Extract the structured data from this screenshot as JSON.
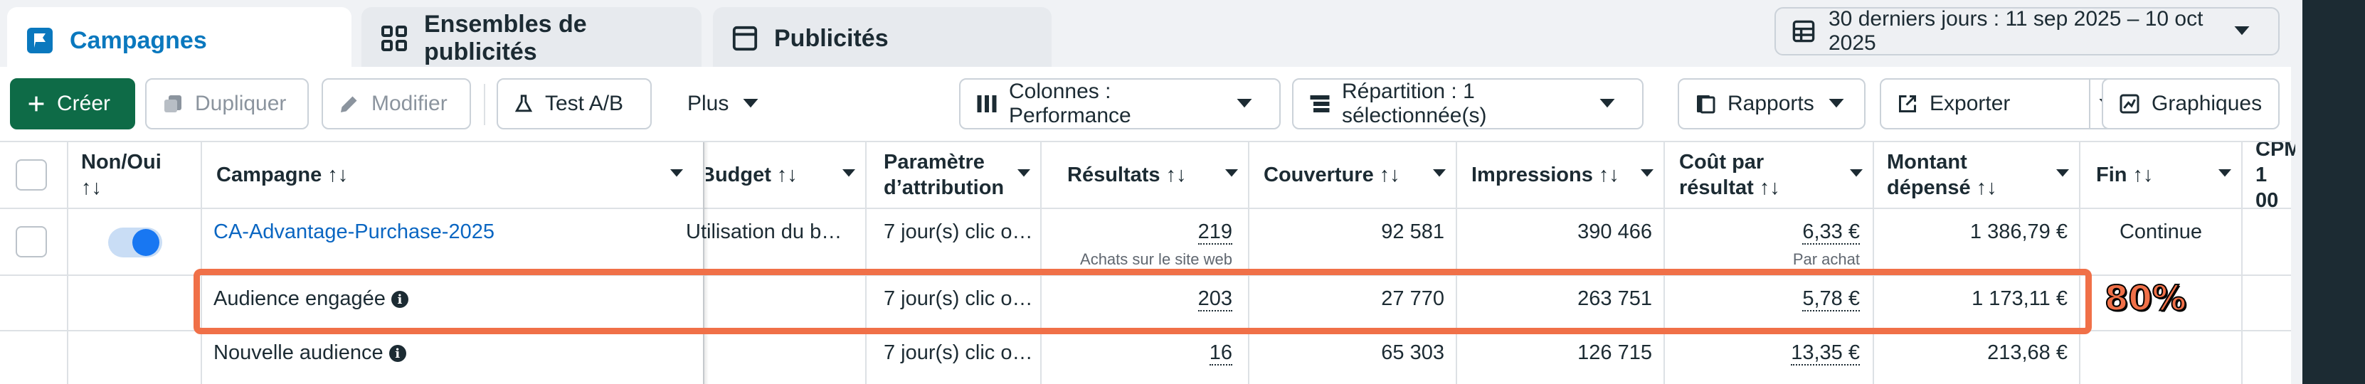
{
  "tabs": [
    {
      "label": "Campagnes",
      "icon": "flag-icon",
      "active": true
    },
    {
      "label": "Ensembles de publicités",
      "icon": "grid-icon",
      "active": false
    },
    {
      "label": "Publicités",
      "icon": "ad-card-icon",
      "active": false
    }
  ],
  "date_range": {
    "label": "30 derniers jours : 11 sep 2025 – 10 oct 2025",
    "icon": "calendar-icon"
  },
  "toolbar": {
    "create": "Créer",
    "duplicate": "Dupliquer",
    "edit": "Modifier",
    "ab_test": "Test A/B",
    "more": "Plus",
    "columns": "Colonnes : Performance",
    "breakdown": "Répartition : 1 sélectionnée(s)",
    "reports": "Rapports",
    "export": "Exporter",
    "charts": "Graphiques"
  },
  "table": {
    "headers": {
      "on_off": [
        "Non/Oui",
        "↑↓"
      ],
      "campaign": "Campagne ↑↓",
      "budget": "Budget ↑↓",
      "attribution": [
        "Paramètre",
        "d’attribution"
      ],
      "results": "Résultats ↑↓",
      "reach": "Couverture ↑↓",
      "impressions": "Impressions ↑↓",
      "cost_per_result": [
        "Coût par",
        "résultat ↑↓"
      ],
      "amount_spent": [
        "Montant",
        "dépensé ↑↓"
      ],
      "end": "Fin ↑↓",
      "cpm": [
        "CPM",
        "1 00"
      ]
    },
    "rows": [
      {
        "name": "CA-Advantage-Purchase-2025",
        "budget": "Utilisation du b…",
        "attribution": "7 jour(s) clic o…",
        "results": "219",
        "results_sub": "Achats sur le site web",
        "reach": "92 581",
        "impressions": "390 466",
        "cost_per_result": "6,33 €",
        "cost_sub": "Par achat",
        "amount_spent": "1 386,79 €",
        "end": "Continue"
      },
      {
        "name": "Audience engagée",
        "attribution": "7 jour(s) clic o…",
        "results": "203",
        "reach": "27 770",
        "impressions": "263 751",
        "cost_per_result": "5,78 €",
        "amount_spent": "1 173,11 €"
      },
      {
        "name": "Nouvelle audience",
        "attribution": "7 jour(s) clic o…",
        "results": "16",
        "reach": "65 303",
        "impressions": "126 715",
        "cost_per_result": "13,35 €",
        "amount_spent": "213,68 €"
      }
    ]
  },
  "annotation": {
    "label": "80%",
    "color": "#f07048"
  },
  "colors": {
    "accent": "#0a78be",
    "primary_button": "#0e6b47",
    "toggle_on": "#1877f2"
  }
}
